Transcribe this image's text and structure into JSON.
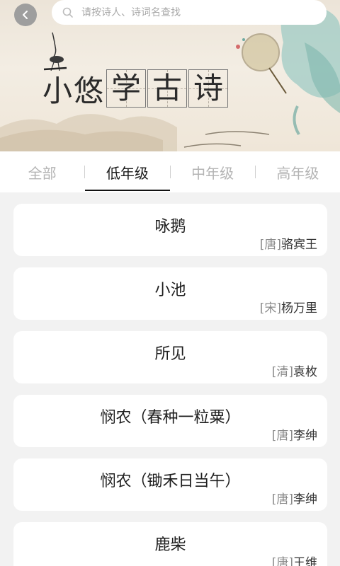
{
  "search": {
    "placeholder": "请按诗人、诗词名查找"
  },
  "banner": {
    "logo_plain": "小悠",
    "logo_boxed": [
      "学",
      "古",
      "诗"
    ]
  },
  "tabs": [
    {
      "label": "全部",
      "active": false
    },
    {
      "label": "低年级",
      "active": true
    },
    {
      "label": "中年级",
      "active": false
    },
    {
      "label": "高年级",
      "active": false
    }
  ],
  "poems": [
    {
      "title": "咏鹅",
      "dynasty": "[唐]",
      "author": "骆宾王"
    },
    {
      "title": "小池",
      "dynasty": "[宋]",
      "author": "杨万里"
    },
    {
      "title": "所见",
      "dynasty": "[清]",
      "author": "袁枚"
    },
    {
      "title": "悯农（春种一粒粟）",
      "dynasty": "[唐]",
      "author": "李绅"
    },
    {
      "title": "悯农（锄禾日当午）",
      "dynasty": "[唐]",
      "author": "李绅"
    },
    {
      "title": "鹿柴",
      "dynasty": "[唐]",
      "author": "王维"
    }
  ],
  "colors": {
    "tab_active": "#1a1a1a",
    "tab_inactive": "#b4b4b4",
    "card_bg": "#ffffff"
  },
  "icons": {
    "back": "chevron-left-icon",
    "search": "search-icon"
  }
}
